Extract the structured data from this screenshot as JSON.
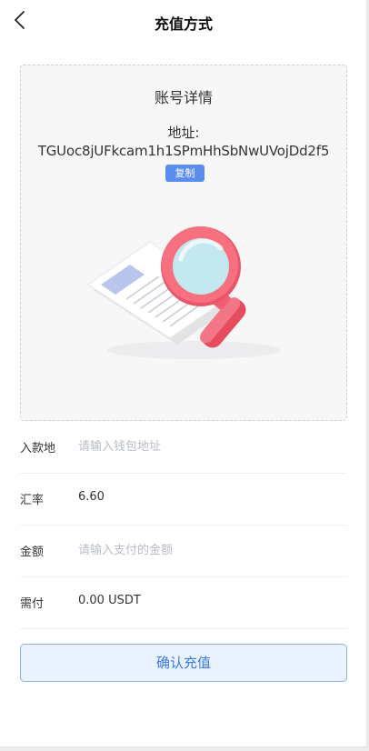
{
  "header": {
    "title": "充值方式",
    "back_icon": "chevron-left-icon"
  },
  "account": {
    "title": "账号详情",
    "address_label": "地址:",
    "address": "TGUoc8jUFkcam1h1SPmHhSbNwUVojDd2f5",
    "copy_label": "复制",
    "illustration": "magnifier-document-illustration"
  },
  "form": {
    "deposit_address": {
      "label": "入款地",
      "placeholder": "请输入钱包地址"
    },
    "rate": {
      "label": "汇率",
      "value": "6.60"
    },
    "amount": {
      "label": "金额",
      "placeholder": "请输入支付的金额"
    },
    "required": {
      "label": "需付",
      "value": "0.00 USDT"
    }
  },
  "actions": {
    "confirm_label": "确认充值"
  },
  "colors": {
    "accent": "#5b8df0",
    "button_text": "#3e79de",
    "button_bg": "#eaf2fd",
    "magnifier": "#f06272"
  }
}
